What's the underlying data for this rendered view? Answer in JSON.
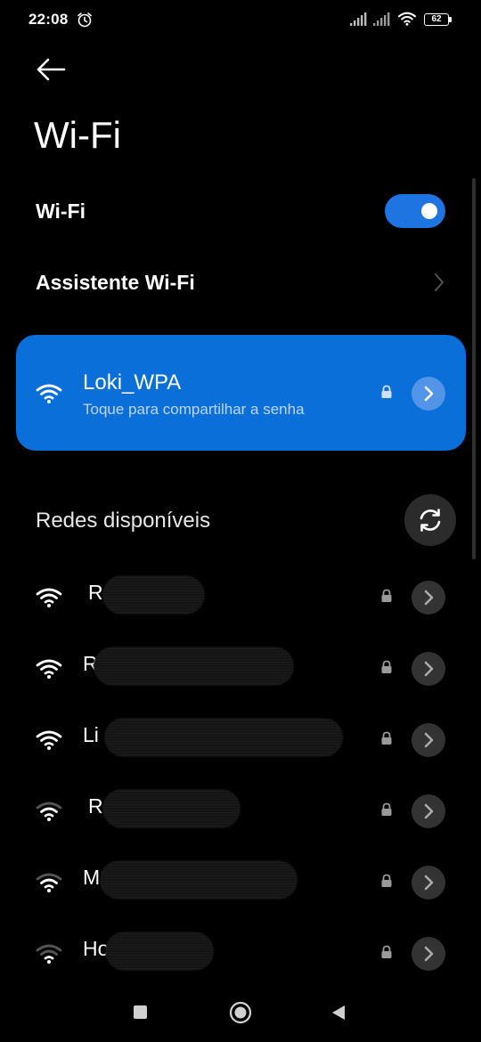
{
  "status_bar": {
    "time": "22:08",
    "battery": "62"
  },
  "header": {
    "title": "Wi-Fi"
  },
  "wifi_toggle": {
    "label": "Wi-Fi",
    "enabled": true
  },
  "assistant": {
    "label": "Assistente Wi-Fi"
  },
  "connected": {
    "name": "Loki_WPA",
    "subtitle": "Toque para compartilhar a senha"
  },
  "available": {
    "title": "Redes disponíveis",
    "networks": [
      {
        "name": "R",
        "signal": "full",
        "secured": true
      },
      {
        "name": "R",
        "signal": "full",
        "secured": true
      },
      {
        "name": "Li",
        "signal": "full",
        "secured": true
      },
      {
        "name": "R",
        "signal": "medium",
        "secured": true
      },
      {
        "name": "M",
        "signal": "medium",
        "secured": true
      },
      {
        "name": "Ho",
        "signal": "low",
        "secured": true
      }
    ]
  },
  "colors": {
    "accent": "#0a6fd8",
    "toggle_on": "#1e74e0",
    "background": "#000000"
  }
}
